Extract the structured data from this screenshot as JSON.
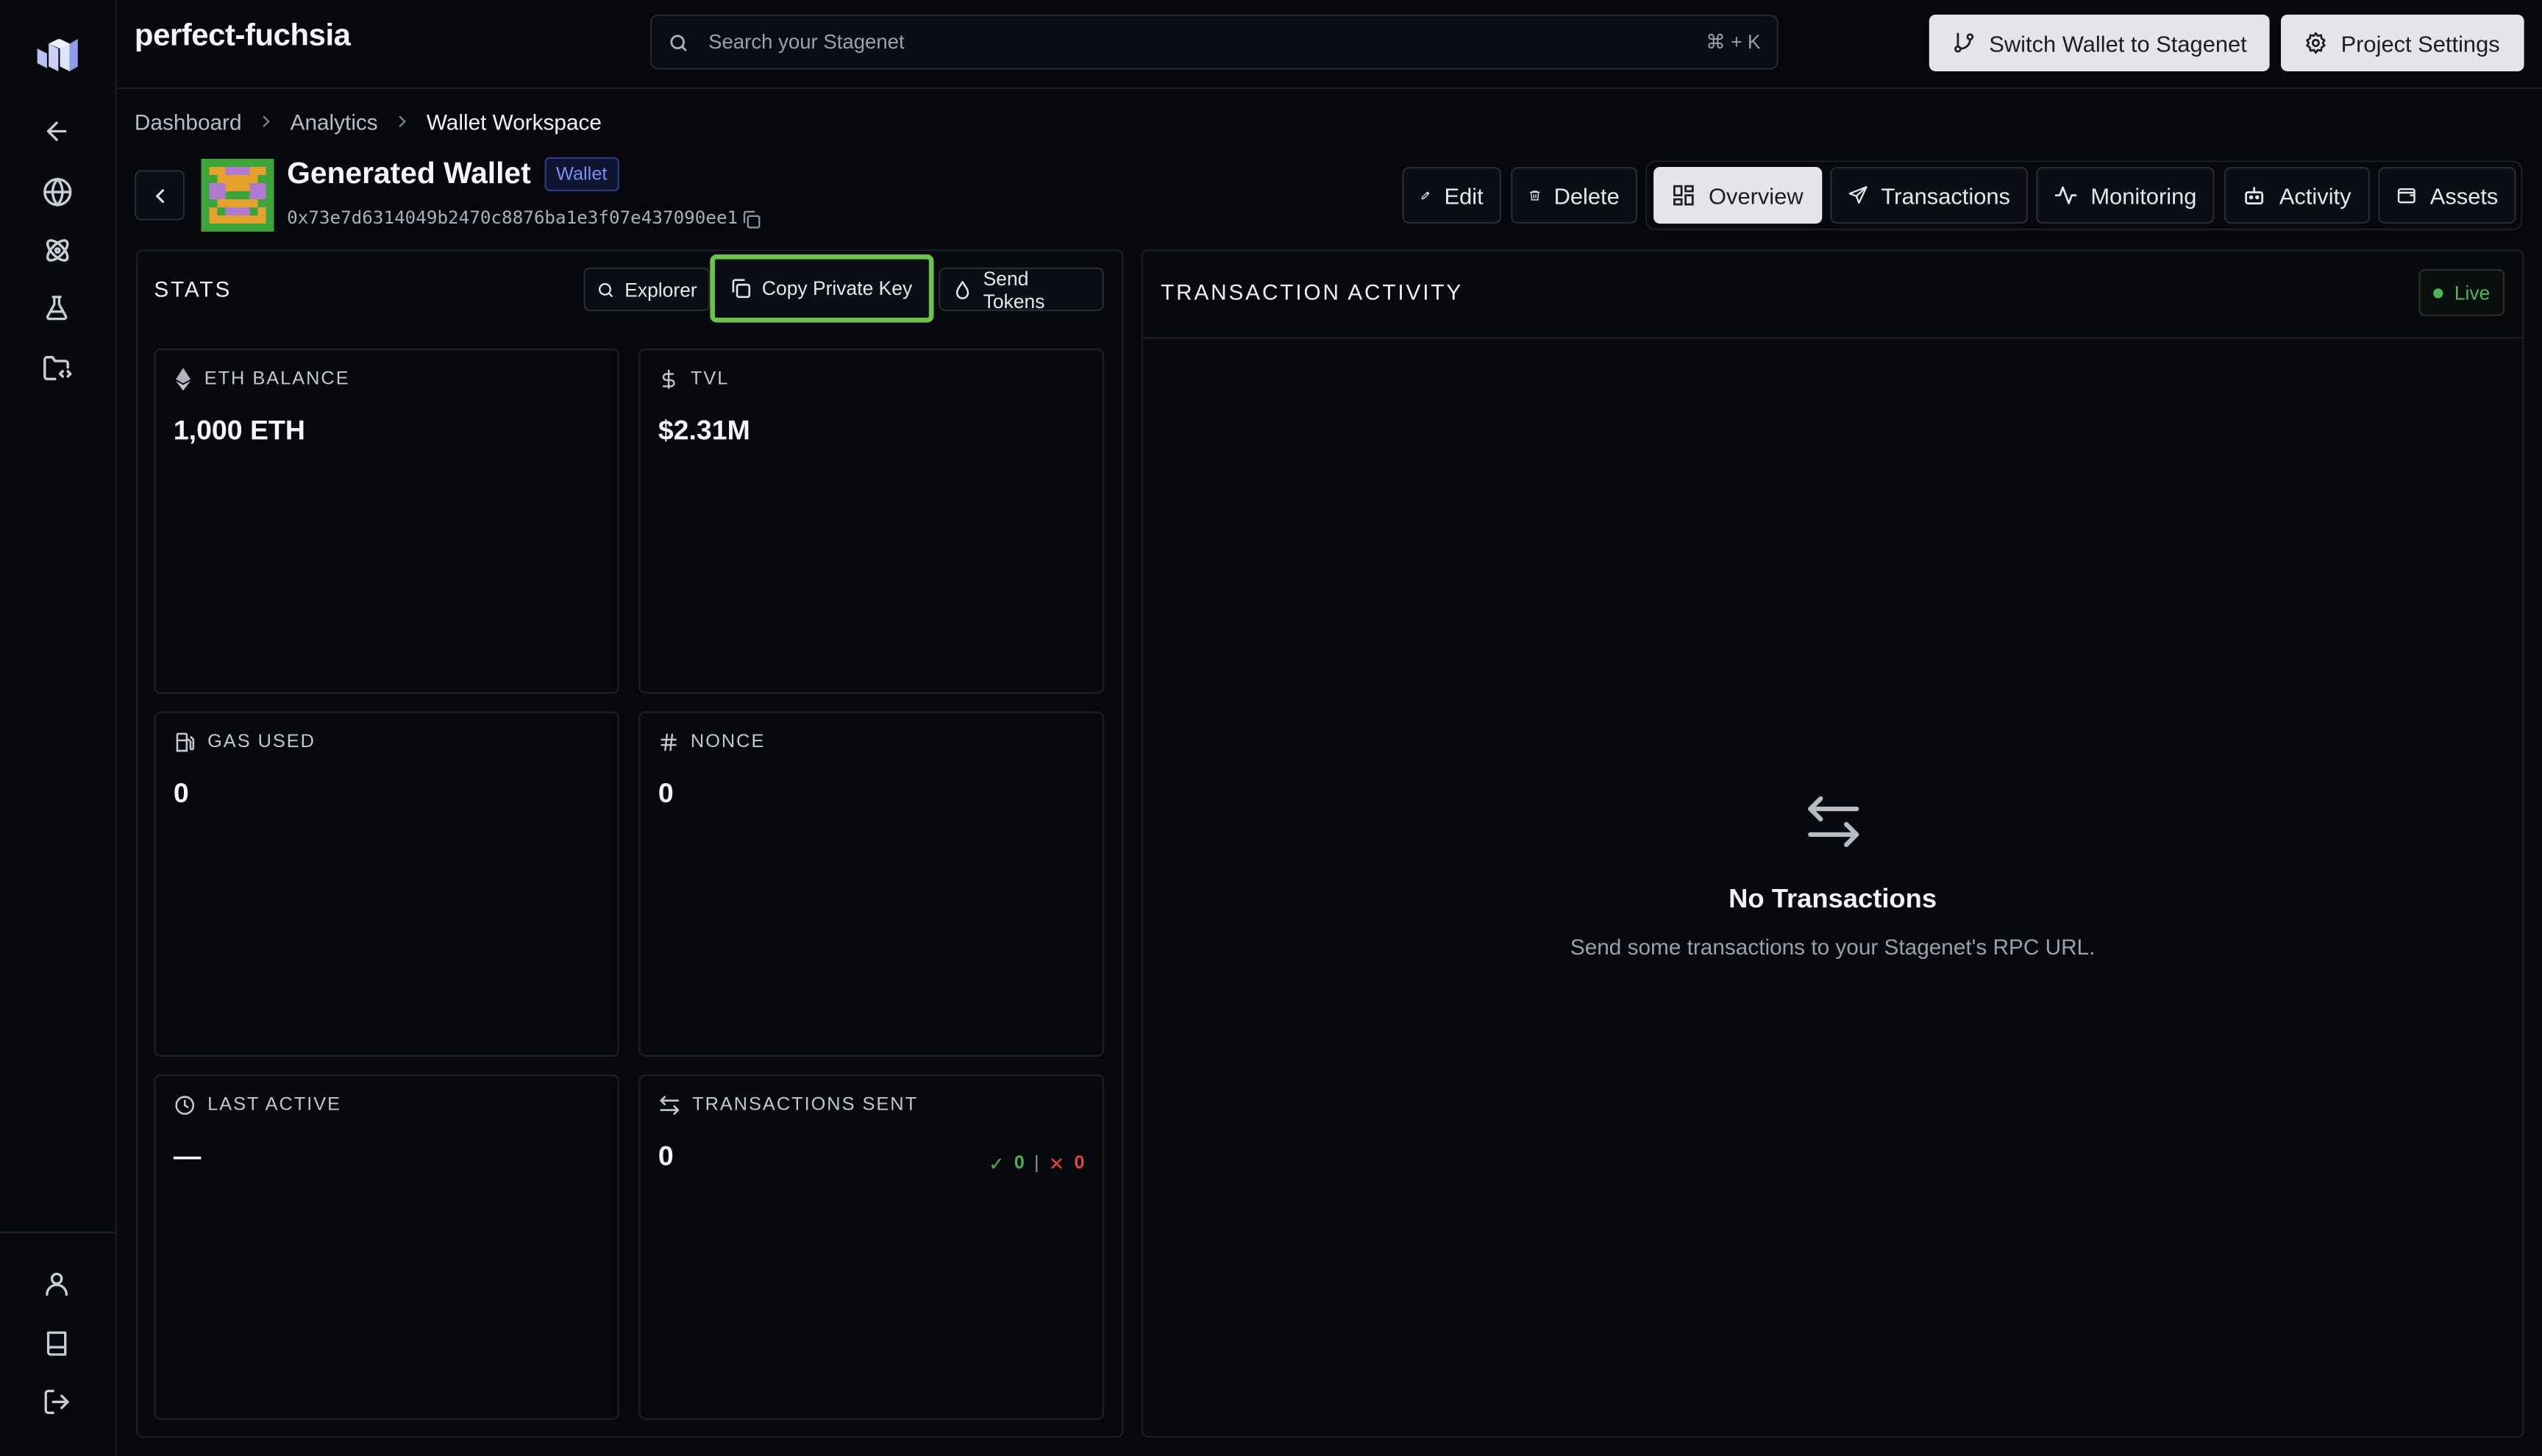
{
  "project": {
    "name": "perfect-fuchsia"
  },
  "search": {
    "placeholder": "Search your Stagenet",
    "shortcut": "⌘ + K"
  },
  "topbar": {
    "switch_wallet_label": "Switch Wallet to Stagenet",
    "project_settings_label": "Project Settings"
  },
  "breadcrumb": [
    "Dashboard",
    "Analytics",
    "Wallet Workspace"
  ],
  "wallet": {
    "name": "Generated Wallet",
    "badge": "Wallet",
    "address": "0x73e7d6314049b2470c8876ba1e3f07e437090ee1"
  },
  "actions": {
    "edit": "Edit",
    "delete": "Delete"
  },
  "tabs": [
    "Overview",
    "Transactions",
    "Monitoring",
    "Activity",
    "Assets"
  ],
  "active_tab": "Overview",
  "stats": {
    "title": "STATS",
    "buttons": {
      "explorer": "Explorer",
      "copy_private_key": "Copy Private Key",
      "send_tokens": "Send Tokens"
    },
    "cards": {
      "eth_balance": {
        "label": "ETH BALANCE",
        "value": "1,000 ETH"
      },
      "tvl": {
        "label": "TVL",
        "value": "$2.31M"
      },
      "gas_used": {
        "label": "GAS USED",
        "value": "0"
      },
      "nonce": {
        "label": "NONCE",
        "value": "0"
      },
      "last_active": {
        "label": "LAST ACTIVE",
        "value": "—"
      },
      "transactions_sent": {
        "label": "TRANSACTIONS SENT",
        "value": "0",
        "succeeded": "0",
        "failed": "0"
      }
    }
  },
  "activity": {
    "title": "TRANSACTION ACTIVITY",
    "live_label": "Live",
    "empty_title": "No Transactions",
    "empty_subtitle": "Send some transactions to your Stagenet's RPC URL."
  },
  "colors": {
    "accent_highlight": "#6cc24a",
    "success": "#4caf50",
    "error": "#e0453b",
    "badge": "#7c8df2"
  },
  "icons": {
    "sidebar": [
      "logo-icon",
      "arrow-left-icon",
      "globe-icon",
      "atom-icon",
      "flask-icon",
      "folder-code-icon",
      "user-icon",
      "book-icon",
      "logout-icon"
    ]
  }
}
